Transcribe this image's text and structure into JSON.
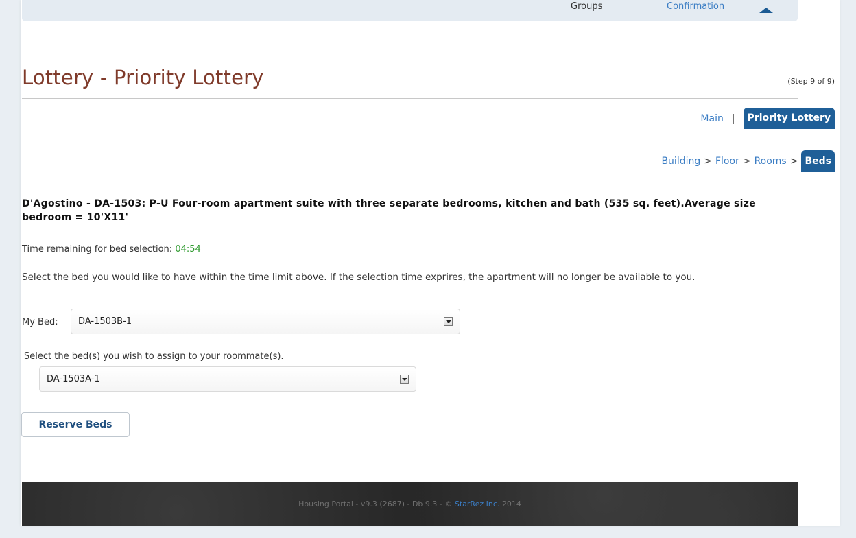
{
  "topnav": {
    "groups_label": "Groups",
    "confirmation_label": "Confirmation"
  },
  "page": {
    "title": "Lottery - Priority Lottery",
    "step": "(Step 9 of 9)"
  },
  "subnav": {
    "main_label": "Main",
    "separator": "|",
    "active_label": "Priority Lottery"
  },
  "breadcrumb": {
    "building": "Building",
    "floor": "Floor",
    "rooms": "Rooms",
    "beds": "Beds",
    "separator": ">"
  },
  "room": {
    "title": "D'Agostino - DA-1503: P-U Four-room apartment suite with three separate bedrooms, kitchen and bath (535 sq. feet).Average size bedroom = 10'X11'"
  },
  "timer": {
    "label": "Time remaining for bed selection:",
    "value": "04:54"
  },
  "instructions": "Select the bed you would like to have within the time limit above. If the selection time exprires, the apartment will no longer be available to you.",
  "my_bed": {
    "label": "My Bed:",
    "selected": "DA-1503B-1"
  },
  "roommate": {
    "label": "Select the bed(s) you wish to assign to your roommate(s).",
    "selected": "DA-1503A-1"
  },
  "actions": {
    "reserve_label": "Reserve Beds"
  },
  "footer": {
    "prefix": "Housing Portal - v9.3 (2687) - Db 9.3 - ©",
    "brand": "StarRez Inc.",
    "year": "2014"
  },
  "colors": {
    "accent": "#1f5f98",
    "title": "#7f3a2a",
    "link": "#3b7dc4",
    "timer": "#2e9a2e"
  }
}
